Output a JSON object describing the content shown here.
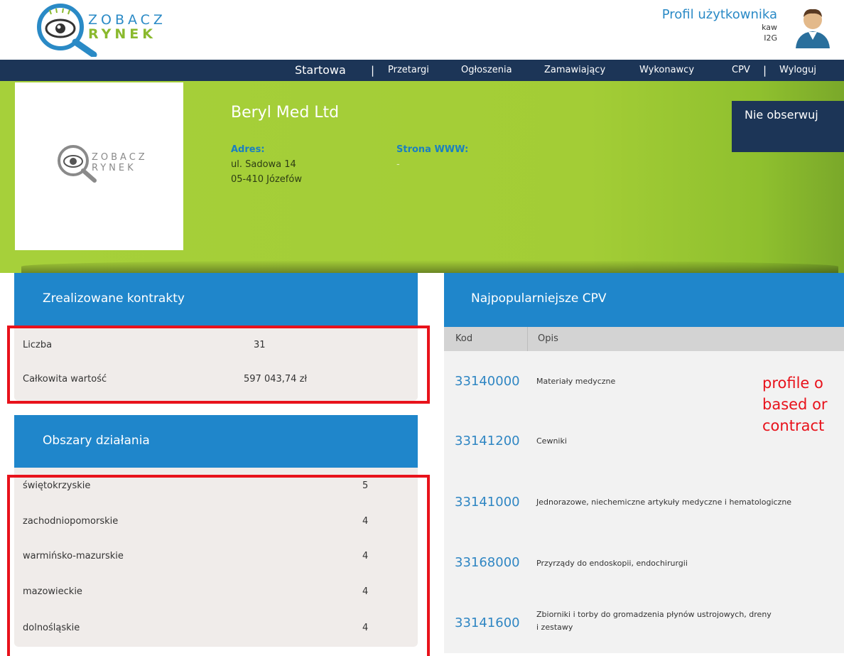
{
  "brand": {
    "line1": "ZOBACZ",
    "line2": "RYNEK"
  },
  "profile": {
    "title": "Profil użytkownika",
    "user": "kaw",
    "org": "I2G"
  },
  "nav": {
    "home": "Startowa",
    "sep": "|",
    "items": [
      "Przetargi",
      "Ogłoszenia",
      "Zamawiający",
      "Wykonawcy",
      "CPV",
      "Wyloguj"
    ]
  },
  "company": {
    "name": "Beryl Med Ltd",
    "address_label": "Adres:",
    "address_line1": "ul. Sadowa 14",
    "address_line2": "05-410 Józefów",
    "www_label": "Strona WWW:",
    "www_value": "-",
    "unfollow_label": "Nie obserwuj"
  },
  "contracts": {
    "title": "Zrealizowane kontrakty",
    "count_label": "Liczba",
    "count_value": "31",
    "total_label": "Całkowita wartość",
    "total_value": "597 043,74 zł"
  },
  "regions": {
    "title": "Obszary działania",
    "items": [
      {
        "name": "świętokrzyskie",
        "count": "5"
      },
      {
        "name": "zachodniopomorskie",
        "count": "4"
      },
      {
        "name": "warmińsko-mazurskie",
        "count": "4"
      },
      {
        "name": "mazowieckie",
        "count": "4"
      },
      {
        "name": "dolnośląskie",
        "count": "4"
      }
    ]
  },
  "cpv": {
    "title": "Najpopularniejsze CPV",
    "col_code": "Kod",
    "col_desc": "Opis",
    "rows": [
      {
        "code": "33140000",
        "desc": "Materiały medyczne"
      },
      {
        "code": "33141200",
        "desc": "Cewniki"
      },
      {
        "code": "33141000",
        "desc": "Jednorazowe, niechemiczne artykuły medyczne i hematologiczne"
      },
      {
        "code": "33168000",
        "desc": "Przyrządy do endoskopii, endochirurgii"
      },
      {
        "code": "33141600",
        "desc": "Zbiorniki i torby do gromadzenia płynów ustrojowych, dreny",
        "desc2": "i zestawy"
      }
    ]
  },
  "annotation": {
    "line1": "profile o",
    "line2": "based or",
    "line3": "contract"
  },
  "colors": {
    "nav": "#1c3557",
    "panel": "#1f86cb",
    "banner": "#a6d03a",
    "highlight": "#e8121b",
    "link": "#2f86c3"
  }
}
